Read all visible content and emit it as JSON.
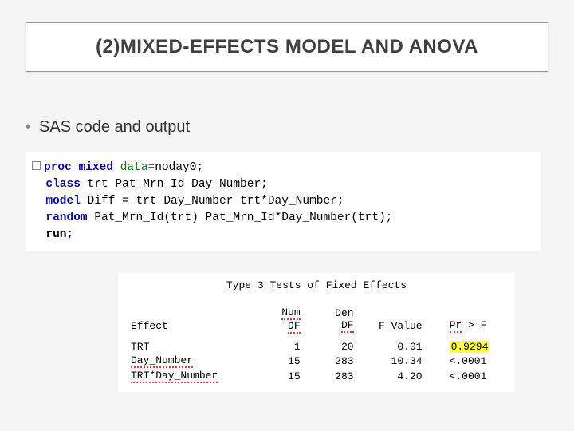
{
  "title": "(2)MIXED-EFFECTS MODEL AND ANOVA",
  "bullet": "SAS code and output",
  "code": {
    "l1_kw": "proc mixed",
    "l1_rest1": " ",
    "l1_opt": "data",
    "l1_rest2": "=noday0;",
    "l2_kw": "class",
    "l2_rest": " trt Pat_Mrn_Id Day_Number;",
    "l3_kw": "model",
    "l3_rest": " Diff = trt Day_Number trt*Day_Number;",
    "l4_kw": "random",
    "l4_rest": " Pat_Mrn_Id(trt) Pat_Mrn_Id*Day_Number(trt);",
    "l5_kw": "run",
    "l5_rest": ";"
  },
  "output": {
    "title": "Type 3 Tests of Fixed Effects",
    "headers": {
      "effect": "Effect",
      "num1": "Num",
      "num2": "DF",
      "den1": "Den",
      "den2": "DF",
      "fval": "F Value",
      "pr1": "Pr",
      "pr2": " > F"
    },
    "rows": [
      {
        "effect": "TRT",
        "num": "1",
        "den": "20",
        "f": "0.01",
        "p": "0.9294",
        "p_hl": true
      },
      {
        "effect": "Day_Number",
        "num": "15",
        "den": "283",
        "f": "10.34",
        "p": "<.0001",
        "p_hl": false
      },
      {
        "effect": "TRT*Day_Number",
        "num": "15",
        "den": "283",
        "f": "4.20",
        "p": "<.0001",
        "p_hl": false
      }
    ]
  }
}
